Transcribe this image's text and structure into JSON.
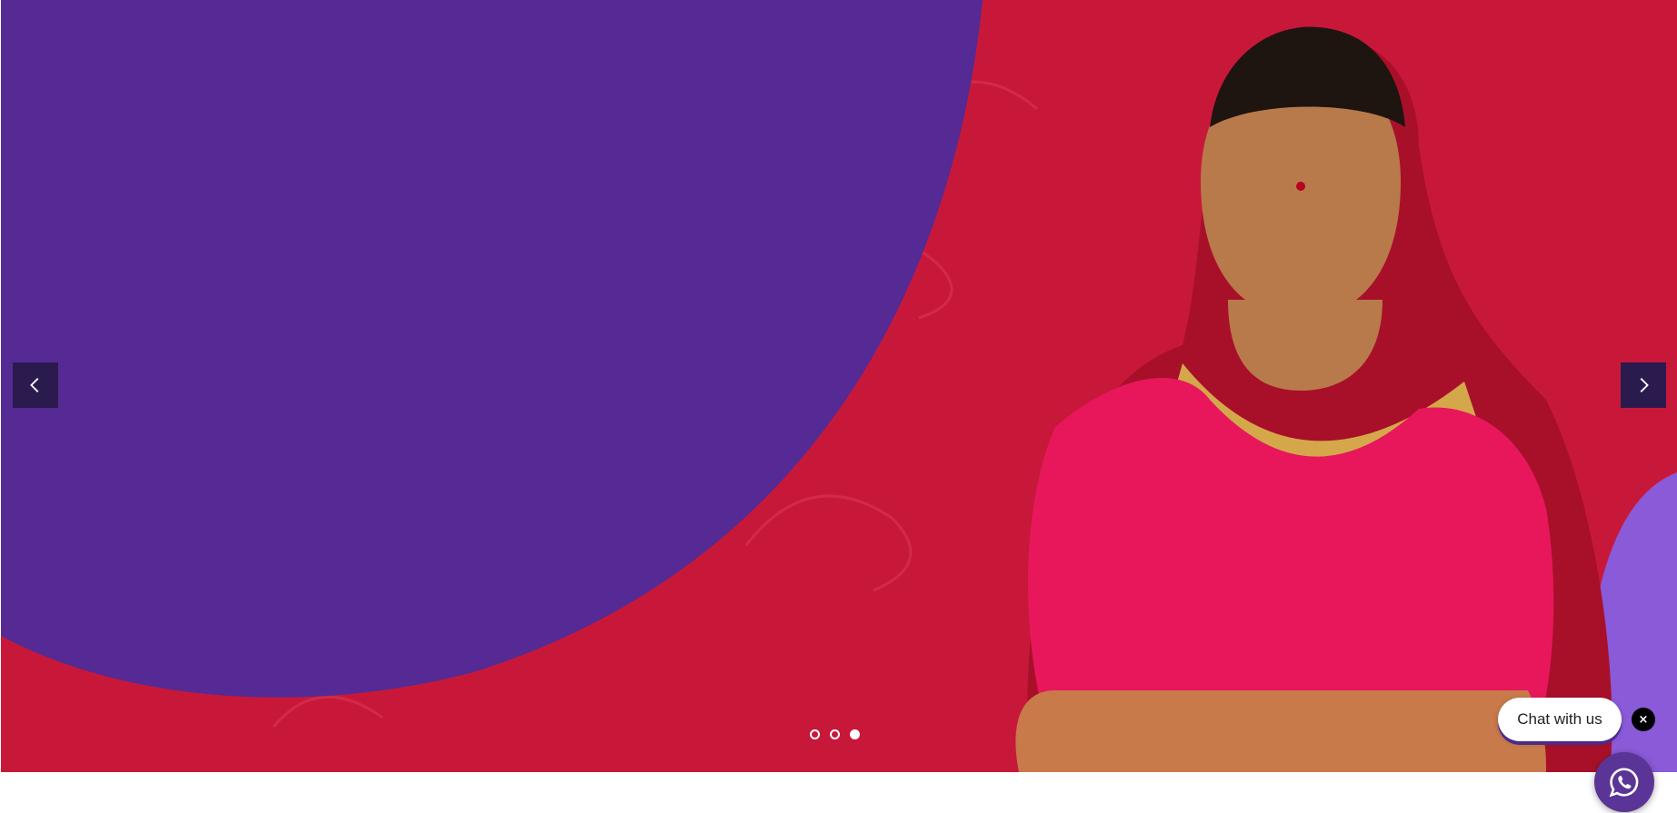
{
  "carousel": {
    "prev_icon": "chevron-left-icon",
    "next_icon": "chevron-right-icon",
    "slide_count": 3,
    "active_slide": 3
  },
  "chat": {
    "label": "Chat with us",
    "close_label": "×",
    "whatsapp_icon": "whatsapp-icon"
  },
  "colors": {
    "purple": "#552a94",
    "crimson": "#c8183a",
    "lilac": "#8a5ad8",
    "nav_bg": "#2b1a4e"
  }
}
